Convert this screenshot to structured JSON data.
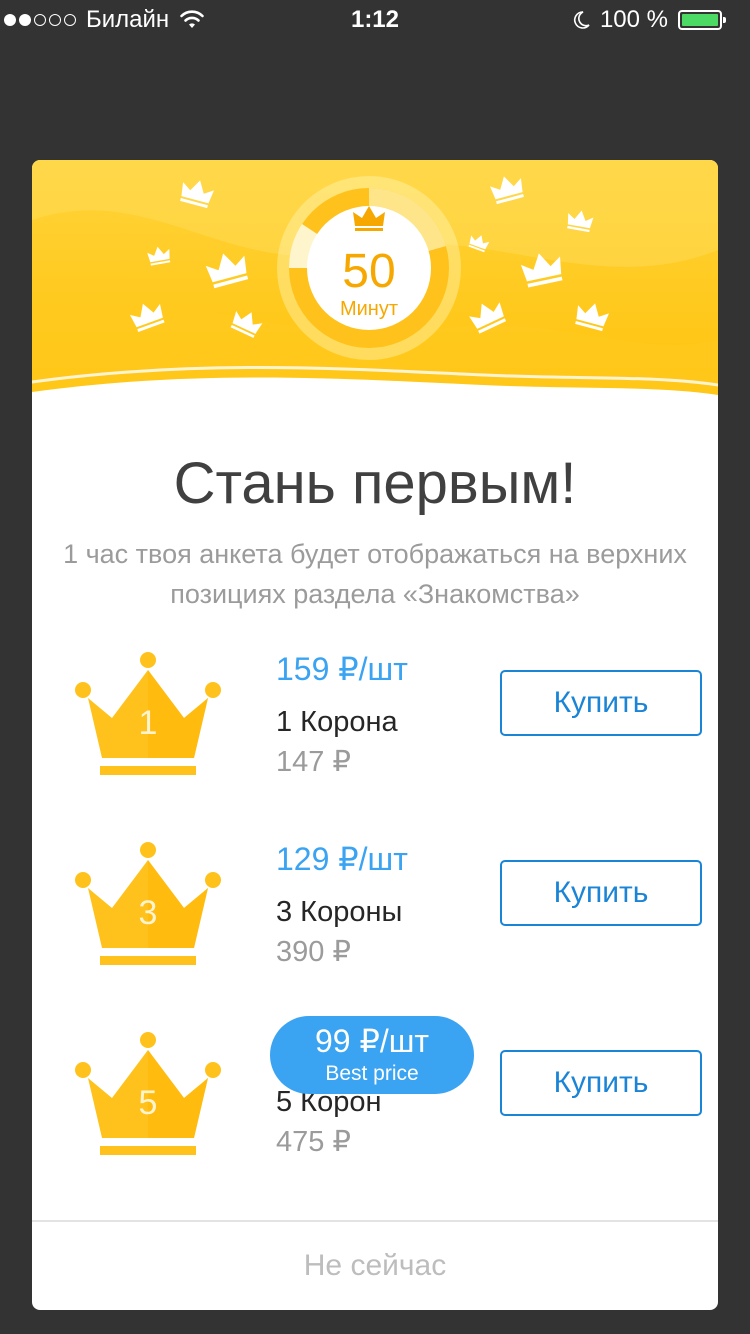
{
  "status_bar": {
    "carrier": "Билайн",
    "time": "1:12",
    "battery": "100 %",
    "battery_level": 1.0,
    "wifi_icon": "wifi-icon",
    "moon_icon": "moon-icon"
  },
  "timer": {
    "value": "50",
    "unit": "Минут"
  },
  "title": "Стань первым!",
  "subtitle": "1 час твоя анкета будет отображаться на верхних позициях раздела «Знакомства»",
  "offers": [
    {
      "crown_count": "1",
      "price": "159 ₽/шт",
      "name": "1 Корона",
      "total": "147 ₽",
      "buy_label": "Купить"
    },
    {
      "crown_count": "3",
      "price": "129 ₽/шт",
      "name": "3 Короны",
      "total": "390 ₽",
      "buy_label": "Купить"
    },
    {
      "crown_count": "5",
      "price": "99 ₽/шт",
      "badge": "Best price",
      "name": "5 Корон",
      "total": "475 ₽",
      "buy_label": "Купить"
    }
  ],
  "not_now": "Не сейчас",
  "colors": {
    "accent_blue": "#3aa3f2",
    "button_blue": "#1a84d6",
    "crown_gold": "#ffc107",
    "header_yellow": "#ffd43b",
    "overlay": "#333333"
  }
}
